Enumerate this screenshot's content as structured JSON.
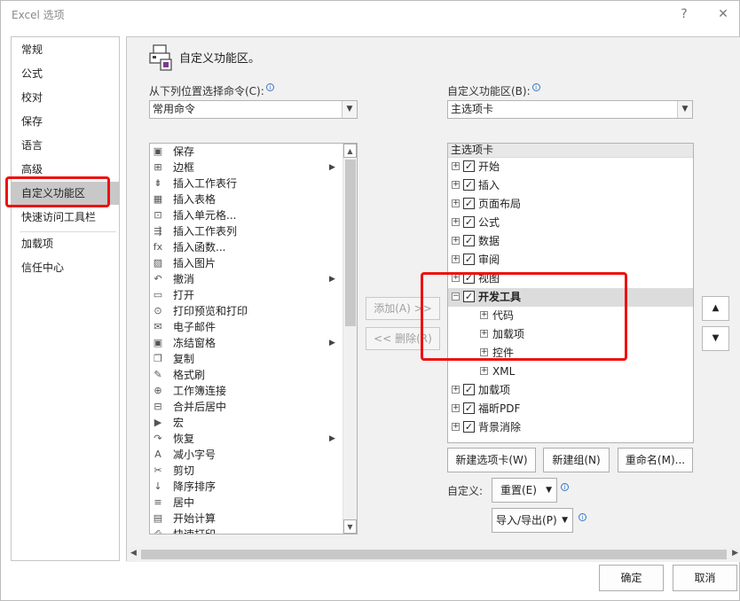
{
  "window": {
    "title": "Excel 选项",
    "help": "?",
    "close": "✕"
  },
  "nav": {
    "items": [
      {
        "label": "常规"
      },
      {
        "label": "公式"
      },
      {
        "label": "校对"
      },
      {
        "label": "保存"
      },
      {
        "label": "语言"
      },
      {
        "label": "高级"
      },
      {
        "label": "自定义功能区"
      },
      {
        "label": "快速访问工具栏"
      },
      {
        "label": "加载项"
      },
      {
        "label": "信任中心"
      }
    ],
    "active": "自定义功能区"
  },
  "page": {
    "title": "自定义功能区。"
  },
  "left_panel": {
    "label": "从下列位置选择命令(C):",
    "combo_value": "常用命令",
    "commands": [
      {
        "label": "保存",
        "icon": "save-icon",
        "glyph": "▣",
        "submenu": false
      },
      {
        "label": "边框",
        "icon": "border-icon",
        "glyph": "⊞",
        "submenu": true
      },
      {
        "label": "插入工作表行",
        "icon": "insert-row-icon",
        "glyph": "⇟",
        "submenu": false
      },
      {
        "label": "插入表格",
        "icon": "insert-table-icon",
        "glyph": "▦",
        "submenu": false
      },
      {
        "label": "插入单元格...",
        "icon": "insert-cell-icon",
        "glyph": "⊡",
        "submenu": false
      },
      {
        "label": "插入工作表列",
        "icon": "insert-column-icon",
        "glyph": "⇶",
        "submenu": false
      },
      {
        "label": "插入函数...",
        "icon": "function-icon",
        "glyph": "fx",
        "submenu": false
      },
      {
        "label": "插入图片",
        "icon": "picture-icon",
        "glyph": "▨",
        "submenu": false
      },
      {
        "label": "撤消",
        "icon": "undo-icon",
        "glyph": "↶",
        "submenu": true
      },
      {
        "label": "打开",
        "icon": "open-folder-icon",
        "glyph": "▭",
        "submenu": false
      },
      {
        "label": "打印预览和打印",
        "icon": "print-preview-icon",
        "glyph": "⊙",
        "submenu": false
      },
      {
        "label": "电子邮件",
        "icon": "email-icon",
        "glyph": "✉",
        "submenu": false
      },
      {
        "label": "冻结窗格",
        "icon": "freeze-panes-icon",
        "glyph": "▣",
        "submenu": true
      },
      {
        "label": "复制",
        "icon": "copy-icon",
        "glyph": "❐",
        "submenu": false
      },
      {
        "label": "格式刷",
        "icon": "format-painter-icon",
        "glyph": "✎",
        "submenu": false
      },
      {
        "label": "工作簿连接",
        "icon": "workbook-connection-icon",
        "glyph": "⊕",
        "submenu": false
      },
      {
        "label": "合并后居中",
        "icon": "merge-center-icon",
        "glyph": "⊟",
        "submenu": false
      },
      {
        "label": "宏",
        "icon": "macro-icon",
        "glyph": "▶",
        "submenu": false
      },
      {
        "label": "恢复",
        "icon": "redo-icon",
        "glyph": "↷",
        "submenu": true
      },
      {
        "label": "减小字号",
        "icon": "decrease-font-icon",
        "glyph": "A",
        "submenu": false
      },
      {
        "label": "剪切",
        "icon": "cut-icon",
        "glyph": "✂",
        "submenu": false
      },
      {
        "label": "降序排序",
        "icon": "sort-descending-icon",
        "glyph": "↓",
        "submenu": false
      },
      {
        "label": "居中",
        "icon": "align-center-icon",
        "glyph": "≡",
        "submenu": false
      },
      {
        "label": "开始计算",
        "icon": "calculate-icon",
        "glyph": "▤",
        "submenu": false
      },
      {
        "label": "快速打印",
        "icon": "quick-print-icon",
        "glyph": "⎙",
        "submenu": false
      }
    ]
  },
  "middle": {
    "add": "添加(A) >>",
    "remove": "<< 删除(R)"
  },
  "right_panel": {
    "label": "自定义功能区(B):",
    "combo_value": "主选项卡",
    "tree_header": "主选项卡",
    "tree": [
      {
        "label": "开始",
        "level": 0,
        "expander": "+",
        "checked": true
      },
      {
        "label": "插入",
        "level": 0,
        "expander": "+",
        "checked": true
      },
      {
        "label": "页面布局",
        "level": 0,
        "expander": "+",
        "checked": true
      },
      {
        "label": "公式",
        "level": 0,
        "expander": "+",
        "checked": true
      },
      {
        "label": "数据",
        "level": 0,
        "expander": "+",
        "checked": true
      },
      {
        "label": "审阅",
        "level": 0,
        "expander": "+",
        "checked": true
      },
      {
        "label": "视图",
        "level": 0,
        "expander": "+",
        "checked": true
      },
      {
        "label": "开发工具",
        "level": 0,
        "expander": "−",
        "checked": true,
        "selected": true
      },
      {
        "label": "代码",
        "level": 1,
        "expander": "+",
        "checked": null
      },
      {
        "label": "加载项",
        "level": 1,
        "expander": "+",
        "checked": null
      },
      {
        "label": "控件",
        "level": 1,
        "expander": "+",
        "checked": null
      },
      {
        "label": "XML",
        "level": 1,
        "expander": "+",
        "checked": null
      },
      {
        "label": "加载项",
        "level": 0,
        "expander": "+",
        "checked": true
      },
      {
        "label": "福昕PDF",
        "level": 0,
        "expander": "+",
        "checked": true
      },
      {
        "label": "背景消除",
        "level": 0,
        "expander": "+",
        "checked": true
      }
    ],
    "buttons": {
      "new_tab": "新建选项卡(W)",
      "new_group": "新建组(N)",
      "rename": "重命名(M)..."
    },
    "customize_label": "自定义:",
    "reset": "重置(E)",
    "import_export": "导入/导出(P)"
  },
  "footer": {
    "ok": "确定",
    "cancel": "取消"
  },
  "colors": {
    "highlight": "#ee1111",
    "selected_bg": "#dcdcdc",
    "nav_active": "#c8c8c8"
  }
}
